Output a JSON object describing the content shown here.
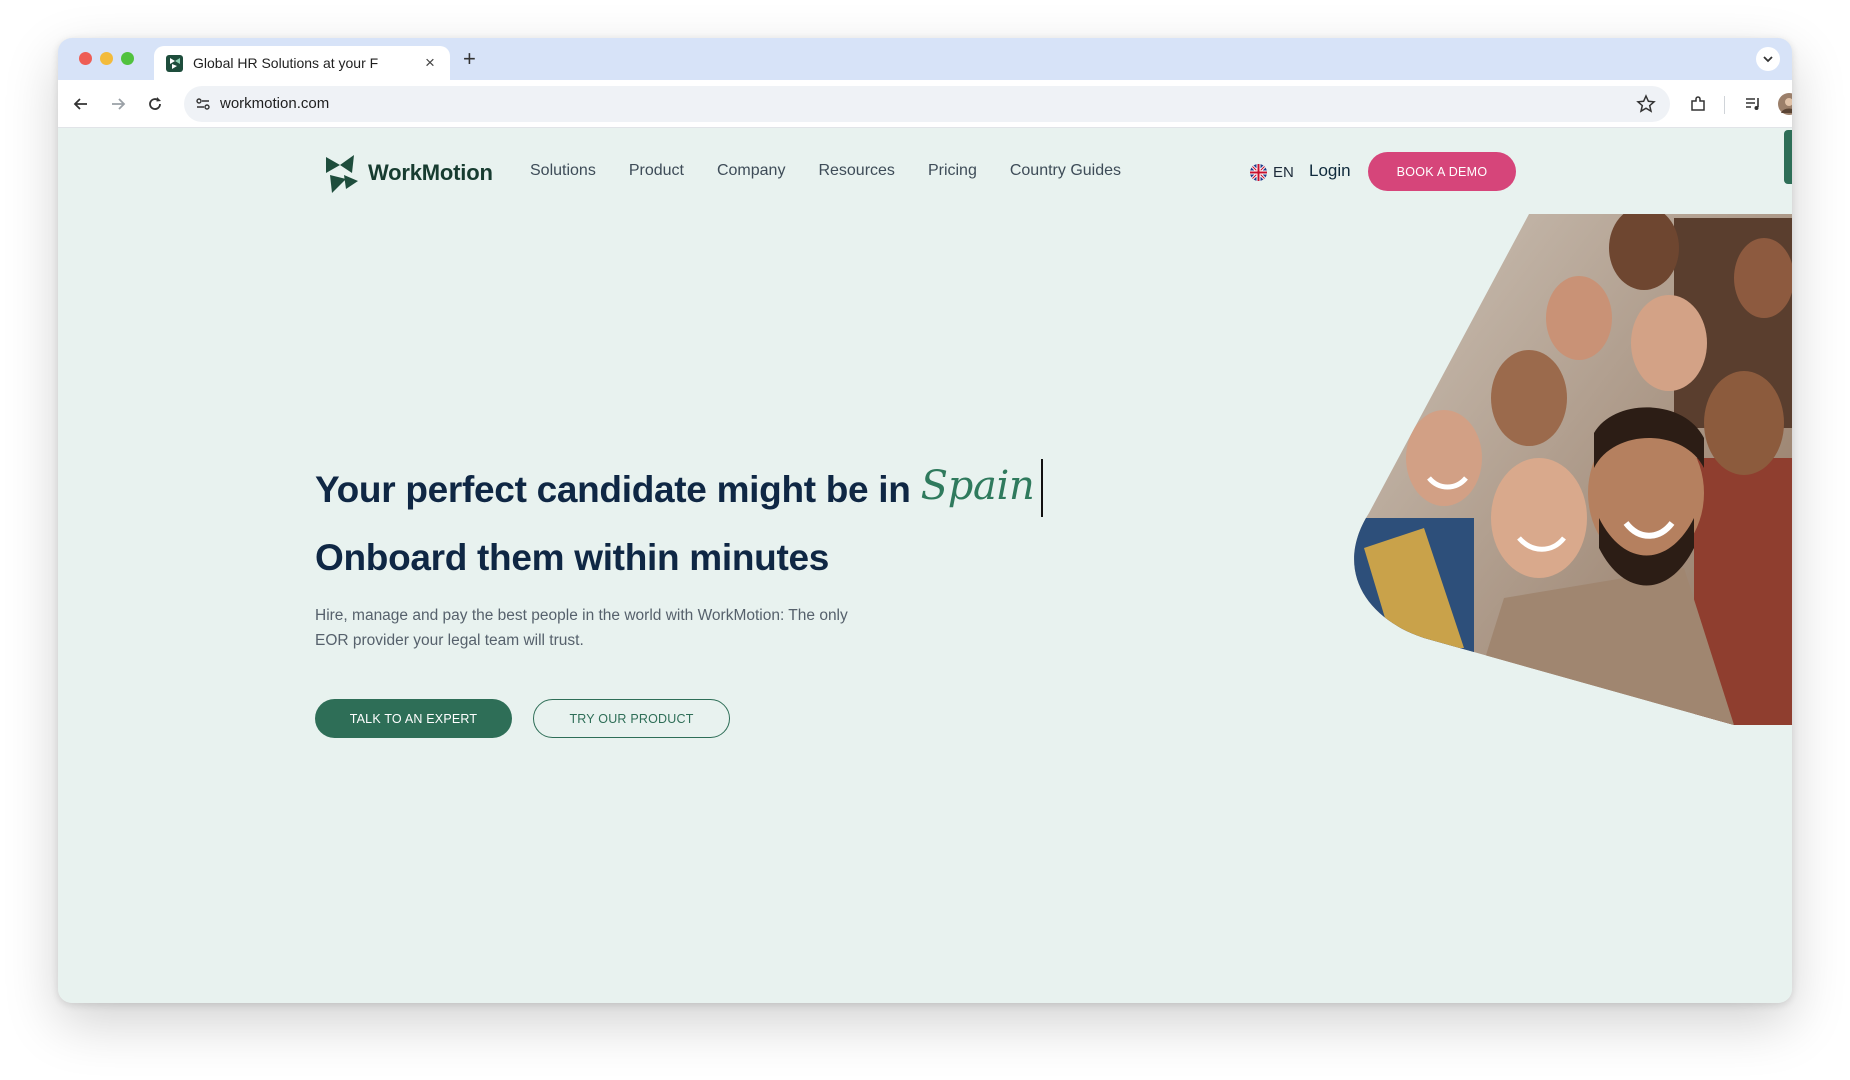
{
  "browser": {
    "tab_title": "Global HR Solutions at your F",
    "url": "workmotion.com"
  },
  "site": {
    "brand": "WorkMotion",
    "nav": [
      "Solutions",
      "Product",
      "Company",
      "Resources",
      "Pricing",
      "Country Guides"
    ],
    "language": "EN",
    "login": "Login",
    "book_demo": "BOOK A DEMO"
  },
  "hero": {
    "headline_prefix": "Your perfect candidate might be in",
    "headline_country": "Spain",
    "headline_line2": "Onboard them within minutes",
    "description": "Hire, manage and pay the best people in the world with WorkMotion: The only EOR provider your legal team will trust.",
    "cta_primary": "TALK TO AN EXPERT",
    "cta_secondary": "TRY OUR PRODUCT",
    "image": "group-of-smiling-people-photo"
  },
  "colors": {
    "page_bg": "#e8f2ef",
    "brand_green": "#2e6e57",
    "headline_navy": "#0f2744",
    "demo_pink": "#d6457a"
  }
}
